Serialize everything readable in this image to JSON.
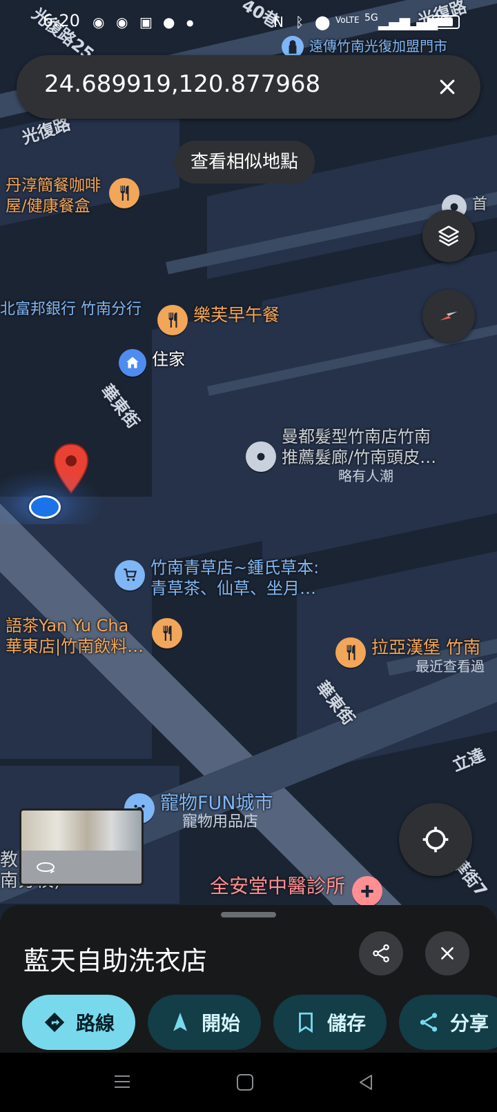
{
  "status_bar": {
    "time": "6:20",
    "network": "5G"
  },
  "search": {
    "query": "24.689919,120.877968"
  },
  "similar_places_label": "查看相似地點",
  "map": {
    "roads": {
      "huadong_1": "華東街",
      "huadong_2": "華東街",
      "guangfu_top": "光復路",
      "guangfu_tl": "光復路25",
      "guangfu_mid": "光復路",
      "lane_top": "40巷",
      "lida": "立達",
      "huadong_lane": "華街7"
    },
    "places": [
      {
        "name": "遠傳竹南光復加盟門市",
        "category": "phone-store"
      },
      {
        "name": "丹淳簡餐咖啡\n屋/健康餐盒",
        "category": "restaurant"
      },
      {
        "name": "首",
        "category": "shop"
      },
      {
        "name": "北富邦銀行 竹南分行",
        "category": "bank"
      },
      {
        "name": "樂芙早午餐",
        "category": "restaurant"
      },
      {
        "name": "住家",
        "category": "home"
      },
      {
        "name": "曼都髮型竹南店竹南\n推薦髮廊/竹南頭皮…",
        "sub": "略有人潮",
        "category": "salon"
      },
      {
        "name": "竹南青草店~鍾氏草本:\n青草茶、仙草、坐月…",
        "category": "shopping"
      },
      {
        "name": "語茶Yan Yu Cha\n華東店|竹南飲料…",
        "category": "restaurant"
      },
      {
        "name": "拉亞漢堡 竹南",
        "sub": "最近查看過",
        "category": "restaurant"
      },
      {
        "name": "寵物FUN城市",
        "sub": "寵物用品店",
        "category": "pet-store"
      },
      {
        "name": "全安堂中醫診所",
        "category": "clinic"
      },
      {
        "name": "教\n南分校)",
        "category": "school"
      }
    ]
  },
  "bottom_sheet": {
    "title": "藍天自助洗衣店",
    "actions": [
      {
        "label": "路線",
        "icon": "directions-icon"
      },
      {
        "label": "開始",
        "icon": "navigation-arrow-icon"
      },
      {
        "label": "儲存",
        "icon": "bookmark-icon"
      },
      {
        "label": "分享",
        "icon": "share-icon"
      }
    ]
  },
  "colors": {
    "accent": "#78d9ec",
    "chip_dark": "#133d47",
    "pin_red": "#e94235",
    "food_pin": "#f2a65a"
  }
}
